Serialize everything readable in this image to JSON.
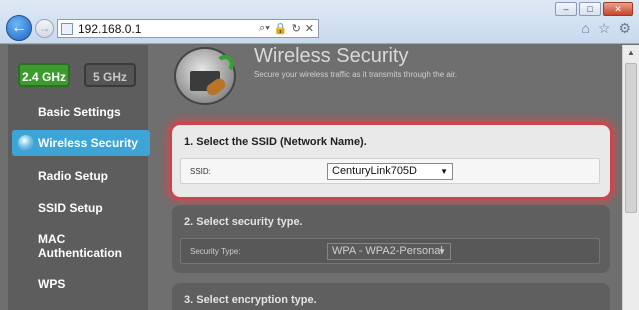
{
  "browser": {
    "url": "192.168.0.1",
    "address_controls": "⌕ ▾ 🔒 ↻ ✕",
    "window_buttons": [
      "–",
      "□",
      "✕"
    ],
    "icons": [
      "home-icon",
      "star-icon",
      "gear-icon"
    ]
  },
  "sidebar": {
    "bands": [
      "2.4 GHz",
      "5 GHz"
    ],
    "items": [
      "Basic Settings",
      "Wireless Security",
      "Radio Setup",
      "SSID Setup",
      "MAC Authentication",
      "WPS"
    ],
    "active_item": "Wireless Security",
    "colors": {
      "active_band": "#3c9a2e",
      "active_item": "#3ca4d6"
    }
  },
  "header": {
    "title": "Wireless Security",
    "subtitle": "Secure your wireless traffic as it transmits through the air."
  },
  "sections": {
    "ssid": {
      "title": "1. Select the SSID (Network Name).",
      "label": "SSID:",
      "value": "CenturyLink705D"
    },
    "security": {
      "title": "2. Select security type.",
      "label": "Security Type:",
      "value": "WPA - WPA2-Personal"
    },
    "encryption": {
      "title": "3. Select encryption type."
    }
  },
  "highlight_color": "#c9474c"
}
